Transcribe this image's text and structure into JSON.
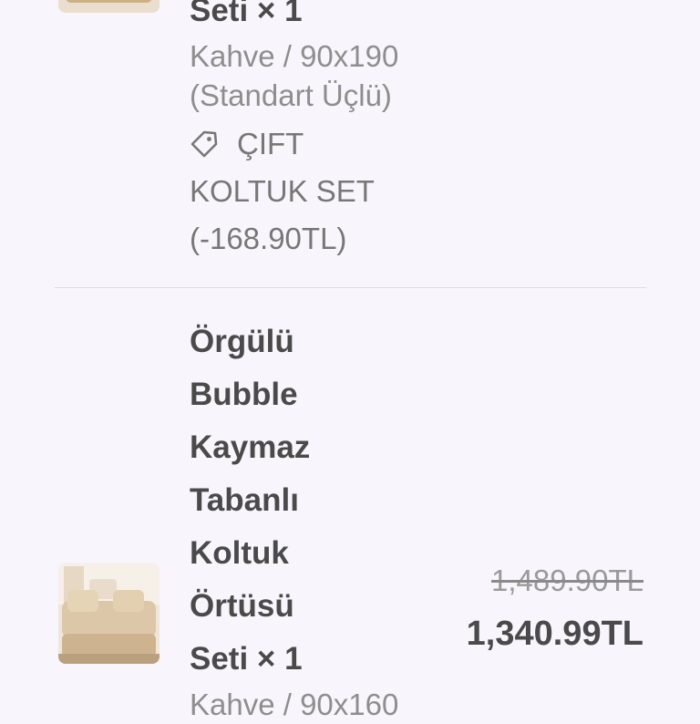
{
  "item1": {
    "title_lines": [
      "Seti × 1"
    ],
    "variant_lines": [
      "Kahve / 90x190",
      "(Standart Üçlü)"
    ],
    "discount_lines": [
      "ÇIFT",
      "KOLTUK SET",
      "(-168.90TL)"
    ],
    "icon": "tag-icon"
  },
  "item2": {
    "title_lines": [
      "Örgülü",
      "Bubble",
      "Kaymaz",
      "Tabanlı",
      "Koltuk",
      "Örtüsü",
      "Seti × 1"
    ],
    "variant_lines": [
      "Kahve / 90x160"
    ],
    "original_price": "1,489.90TL",
    "price": "1,340.99TL"
  },
  "colors": {
    "background": "#f8f6fc",
    "text": "#4a4a4a",
    "muted": "#8e8e8e",
    "divider": "#dcdcdc"
  }
}
